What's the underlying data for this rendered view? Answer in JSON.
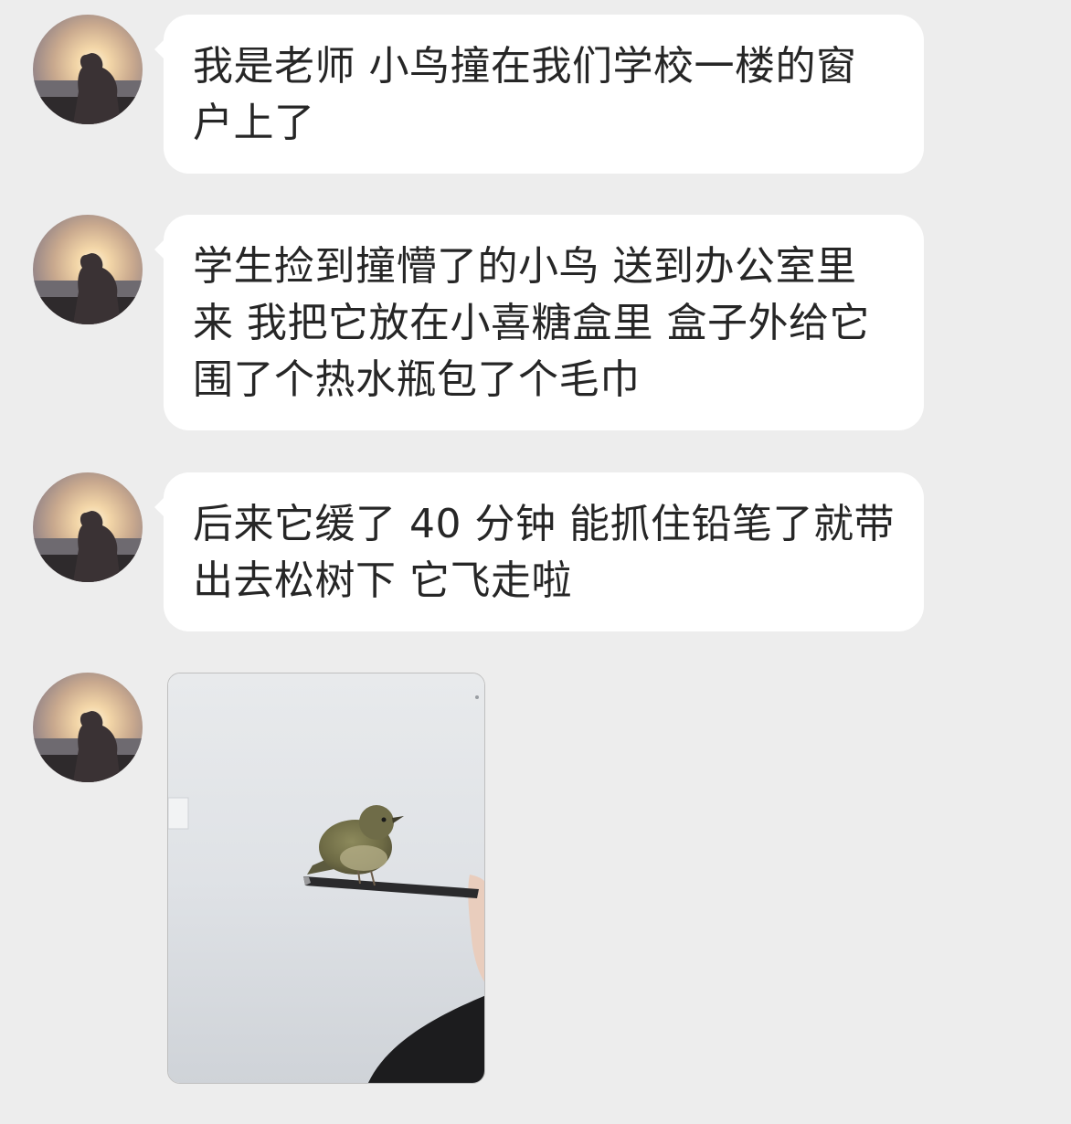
{
  "messages": [
    {
      "type": "text",
      "text": "我是老师 小鸟撞在我们学校一楼的窗户上了"
    },
    {
      "type": "text",
      "text": "学生捡到撞懵了的小鸟 送到办公室里来 我把它放在小喜糖盒里 盒子外给它围了个热水瓶包了个毛巾"
    },
    {
      "type": "text",
      "text": "后来它缓了 40 分钟 能抓住铅笔了就带出去松树下 它飞走啦"
    },
    {
      "type": "image",
      "image_subject": "bird-perched-on-pencil"
    }
  ],
  "colors": {
    "background": "#ededed",
    "bubble": "#ffffff",
    "text": "#262626"
  },
  "icons": {
    "avatar": "sunset-person-avatar"
  }
}
